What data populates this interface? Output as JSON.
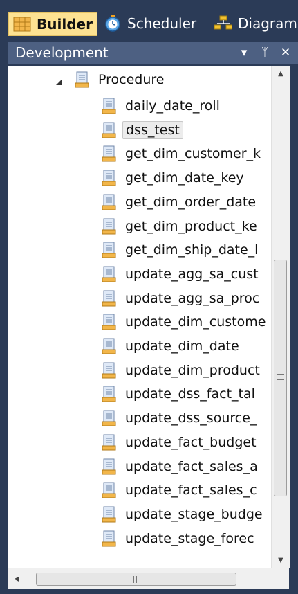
{
  "tabs": [
    {
      "label": "Builder",
      "icon": "builder-grid-icon",
      "active": true
    },
    {
      "label": "Scheduler",
      "icon": "clock-icon",
      "active": false
    },
    {
      "label": "Diagram",
      "icon": "diagram-icon",
      "active": false
    }
  ],
  "panel": {
    "title": "Development",
    "dropdown_icon": "▾",
    "pin_icon": "ᛘ",
    "close_icon": "✕"
  },
  "tree": {
    "group_label": "Procedure",
    "items": [
      {
        "label": "daily_date_roll"
      },
      {
        "label": "dss_test",
        "selected": true
      },
      {
        "label": "get_dim_customer_k"
      },
      {
        "label": "get_dim_date_key"
      },
      {
        "label": "get_dim_order_date"
      },
      {
        "label": "get_dim_product_ke"
      },
      {
        "label": "get_dim_ship_date_l"
      },
      {
        "label": "update_agg_sa_cust"
      },
      {
        "label": "update_agg_sa_proc"
      },
      {
        "label": "update_dim_custome"
      },
      {
        "label": "update_dim_date"
      },
      {
        "label": "update_dim_product"
      },
      {
        "label": "update_dss_fact_tal"
      },
      {
        "label": "update_dss_source_"
      },
      {
        "label": "update_fact_budget"
      },
      {
        "label": "update_fact_sales_a"
      },
      {
        "label": "update_fact_sales_c"
      },
      {
        "label": "update_stage_budge"
      },
      {
        "label": "update_stage_forec"
      }
    ]
  },
  "scrollbar": {
    "up_arrow": "▲",
    "down_arrow": "▼",
    "left_arrow": "◀",
    "right_arrow": "▶"
  },
  "colors": {
    "frame": "#2b3b57",
    "panel_header": "#4d6082",
    "active_tab": "#fde292",
    "selection": "#ececec"
  }
}
